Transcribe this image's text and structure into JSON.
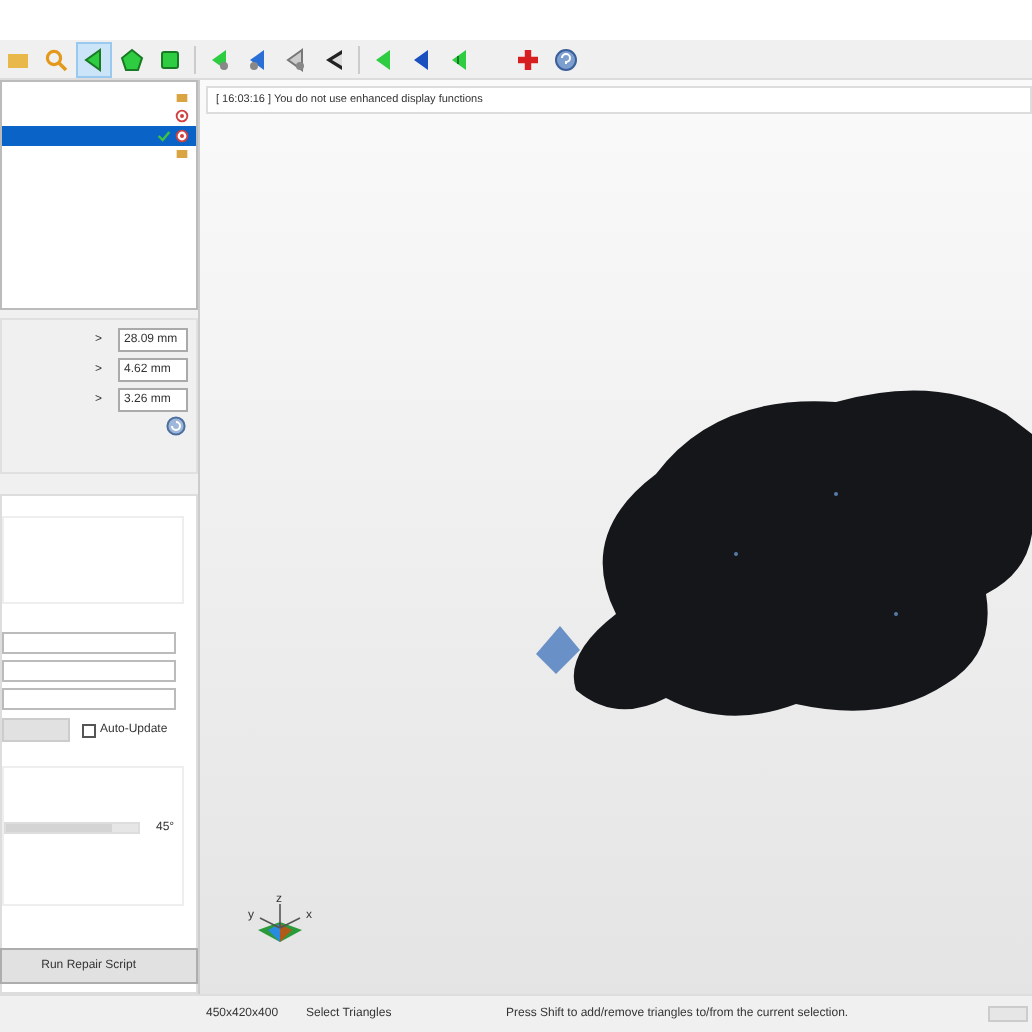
{
  "toolbar": {
    "icons": [
      {
        "kind": "folder",
        "selected": false
      },
      {
        "kind": "magnifier",
        "selected": false
      },
      {
        "kind": "triangle",
        "selected": true
      },
      {
        "kind": "pentagon",
        "selected": false
      },
      {
        "kind": "square",
        "selected": false
      },
      {
        "kind": "tri-green-dot",
        "selected": false
      },
      {
        "kind": "tri-blue-dot",
        "selected": false
      },
      {
        "kind": "tri-grey-dot",
        "selected": false
      },
      {
        "kind": "tri-black",
        "selected": false
      },
      {
        "kind": "tri-green",
        "selected": false
      },
      {
        "kind": "tri-blue",
        "selected": false
      },
      {
        "kind": "tri-green-half",
        "selected": false
      },
      {
        "kind": "plus",
        "selected": false
      },
      {
        "kind": "help",
        "selected": false
      }
    ]
  },
  "tree": {
    "rows": [
      {
        "kind": "folder",
        "checked": false,
        "selected": false
      },
      {
        "kind": "target",
        "checked": false,
        "selected": false
      },
      {
        "kind": "target",
        "checked": true,
        "selected": true
      },
      {
        "kind": "folder",
        "checked": false,
        "selected": false
      }
    ]
  },
  "properties": [
    {
      "arrow": ">",
      "value": "28.09 mm"
    },
    {
      "arrow": ">",
      "value": "4.62 mm"
    },
    {
      "arrow": ">",
      "value": "3.26 mm"
    }
  ],
  "tools": {
    "auto_update": {
      "label": "Auto-Update",
      "checked": false
    },
    "slider": {
      "level": 0.8,
      "reading": "45°"
    },
    "run_button": "Run Repair Script"
  },
  "viewport": {
    "log": "[ 16:03:16 ] You do not use enhanced display functions",
    "axes": {
      "x": "x",
      "y": "y",
      "z": "z"
    }
  },
  "status_bar": {
    "progress": {
      "level": 0
    },
    "size": "450x420x400",
    "mode": "Select Triangles",
    "hint": "Press Shift to add/remove triangles to/from the current selection."
  }
}
